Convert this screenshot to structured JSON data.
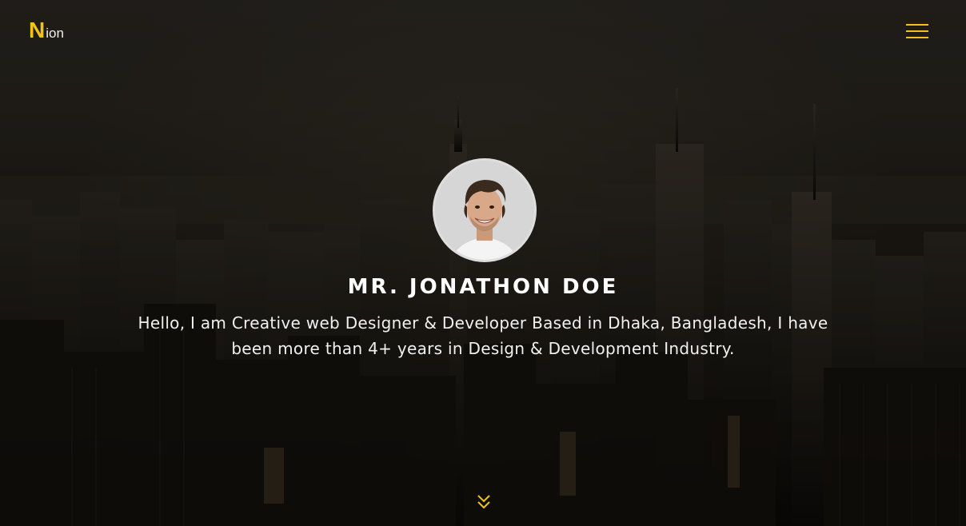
{
  "header": {
    "logo_mark": "N",
    "logo_text": "ion",
    "menu_icon": "hamburger-menu-icon"
  },
  "hero": {
    "name": "MR. JONATHON DOE",
    "bio": "Hello, I am Creative web Designer & Developer Based in Dhaka, Bangladesh, I have been more than 4+ years in Design & Development Industry.",
    "scroll_icon": "double-chevron-down-icon"
  },
  "colors": {
    "accent": "#f2c21b",
    "text": "#ffffff",
    "background": "#1a1712"
  }
}
